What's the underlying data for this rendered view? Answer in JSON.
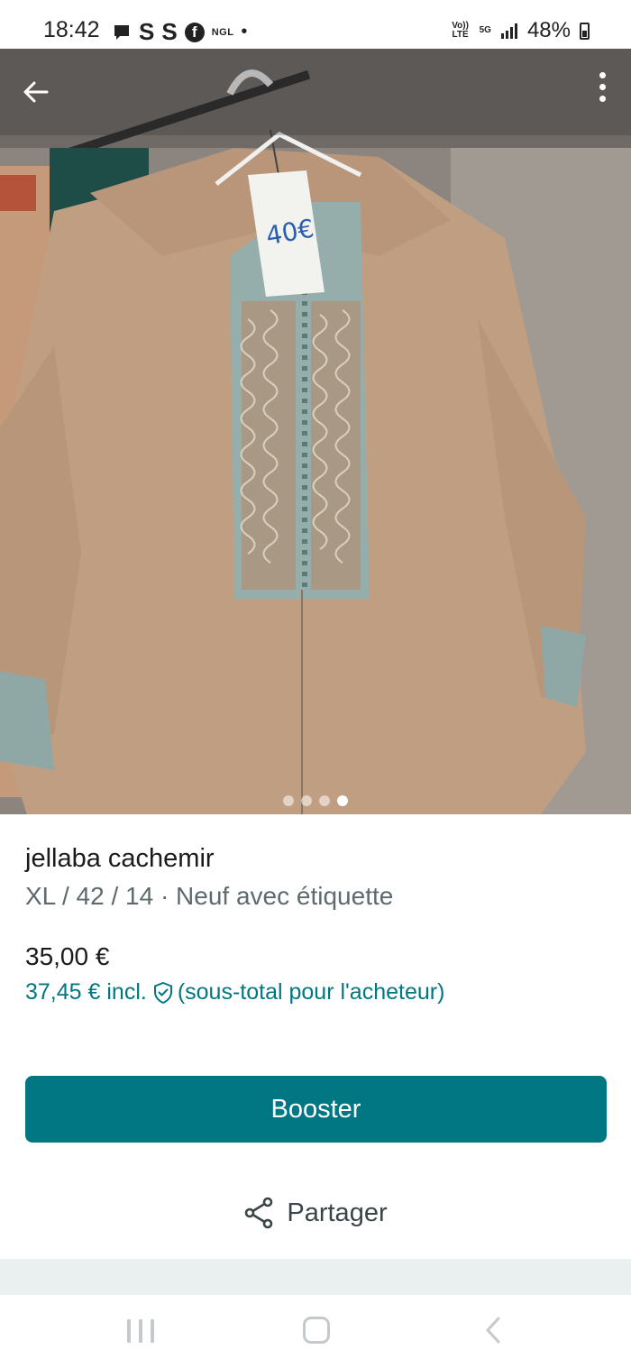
{
  "status_bar": {
    "time": "18:42",
    "notification_icons": [
      "message-icon",
      "s-icon",
      "s-icon",
      "facebook-icon",
      "ngl-icon",
      "dot-icon"
    ],
    "s_glyph": "S",
    "fb_glyph": "f",
    "ngl_label": "NGL",
    "volte_label": "Vo)) LTE",
    "network_label": "5G",
    "battery_percent": "48%"
  },
  "photo": {
    "price_tag_text": "40€",
    "image_count": 4,
    "active_index": 4
  },
  "listing": {
    "title": "jellaba cachemir",
    "details": "XL / 42 / 14 · Neuf avec étiquette",
    "price": "35,00 €",
    "price_incl_amount": "37,45 € incl.",
    "price_incl_note": "(sous-total pour l'acheteur)"
  },
  "actions": {
    "booster_label": "Booster",
    "share_label": "Partager"
  },
  "colors": {
    "accent": "#007782",
    "muted_text": "#5d6a6e"
  }
}
